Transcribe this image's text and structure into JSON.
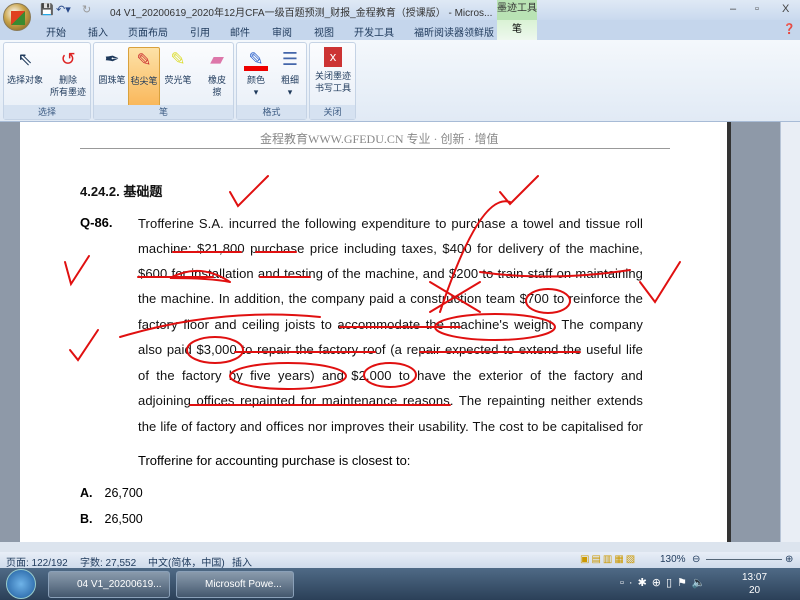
{
  "titlebar": {
    "title": "04 V1_20200619_2020年12月CFA一级百题预测_财报_金程教育（授课版） - Micros...",
    "context_tab": "墨迹工具"
  },
  "tabs": [
    "开始",
    "插入",
    "页面布局",
    "引用",
    "邮件",
    "审阅",
    "视图",
    "开发工具",
    "福昕阅读器领鲜版",
    "笔"
  ],
  "ribbon": {
    "groups": [
      {
        "label": "选择",
        "buttons": [
          "选择对象",
          "删除\n所有墨迹"
        ]
      },
      {
        "label": "笔",
        "buttons": [
          "圆珠笔",
          "毡尖笔",
          "荧光笔",
          "橡皮\n擦"
        ]
      },
      {
        "label": "格式",
        "buttons": [
          "颜色",
          "粗细"
        ]
      },
      {
        "label": "关闭",
        "buttons": [
          "关闭墨迹\n书写工具"
        ]
      }
    ]
  },
  "document": {
    "header": "金程教育WWW.GFEDU.CN 专业 · 创新 · 增值",
    "section": "4.24.2.  基础题",
    "question_number": "Q-86.",
    "lines": [
      "Trofferine S.A. incurred the following expenditure to purchase a towel and tissue roll",
      "machine: $21,800 purchase price including taxes, $400 for delivery of the machine,",
      "$600 for installation and testing of the machine, and $200 to train staff on maintaining",
      "the machine. In addition, the company paid a construction team $700 to reinforce the",
      "factory floor and ceiling joists to accommodate the machine's weight. The company",
      "also paid $3,000 to repair the factory roof (a repair expected to extend the useful life",
      "of the factory by five years) and $2,000 to have the exterior of the factory and",
      "adjoining offices repainted for maintenance reasons. The repainting neither extends",
      "the life of factory and offices nor improves their usability. The cost to be capitalised for"
    ],
    "last_line": "Trofferine for accounting purchase is closest to:",
    "options": [
      {
        "letter": "A.",
        "value": "26,700"
      },
      {
        "letter": "B.",
        "value": "26,500"
      }
    ],
    "ink_color": "#e01010"
  },
  "status": {
    "page": "页面: 122/192",
    "words": "字数: 27,552",
    "lang": "中文(简体，中国)",
    "mode": "插入",
    "zoom": "130%"
  },
  "taskbar": {
    "items": [
      "04 V1_20200619...",
      "Microsoft Powe..."
    ],
    "time": "13:07",
    "date": "20"
  }
}
